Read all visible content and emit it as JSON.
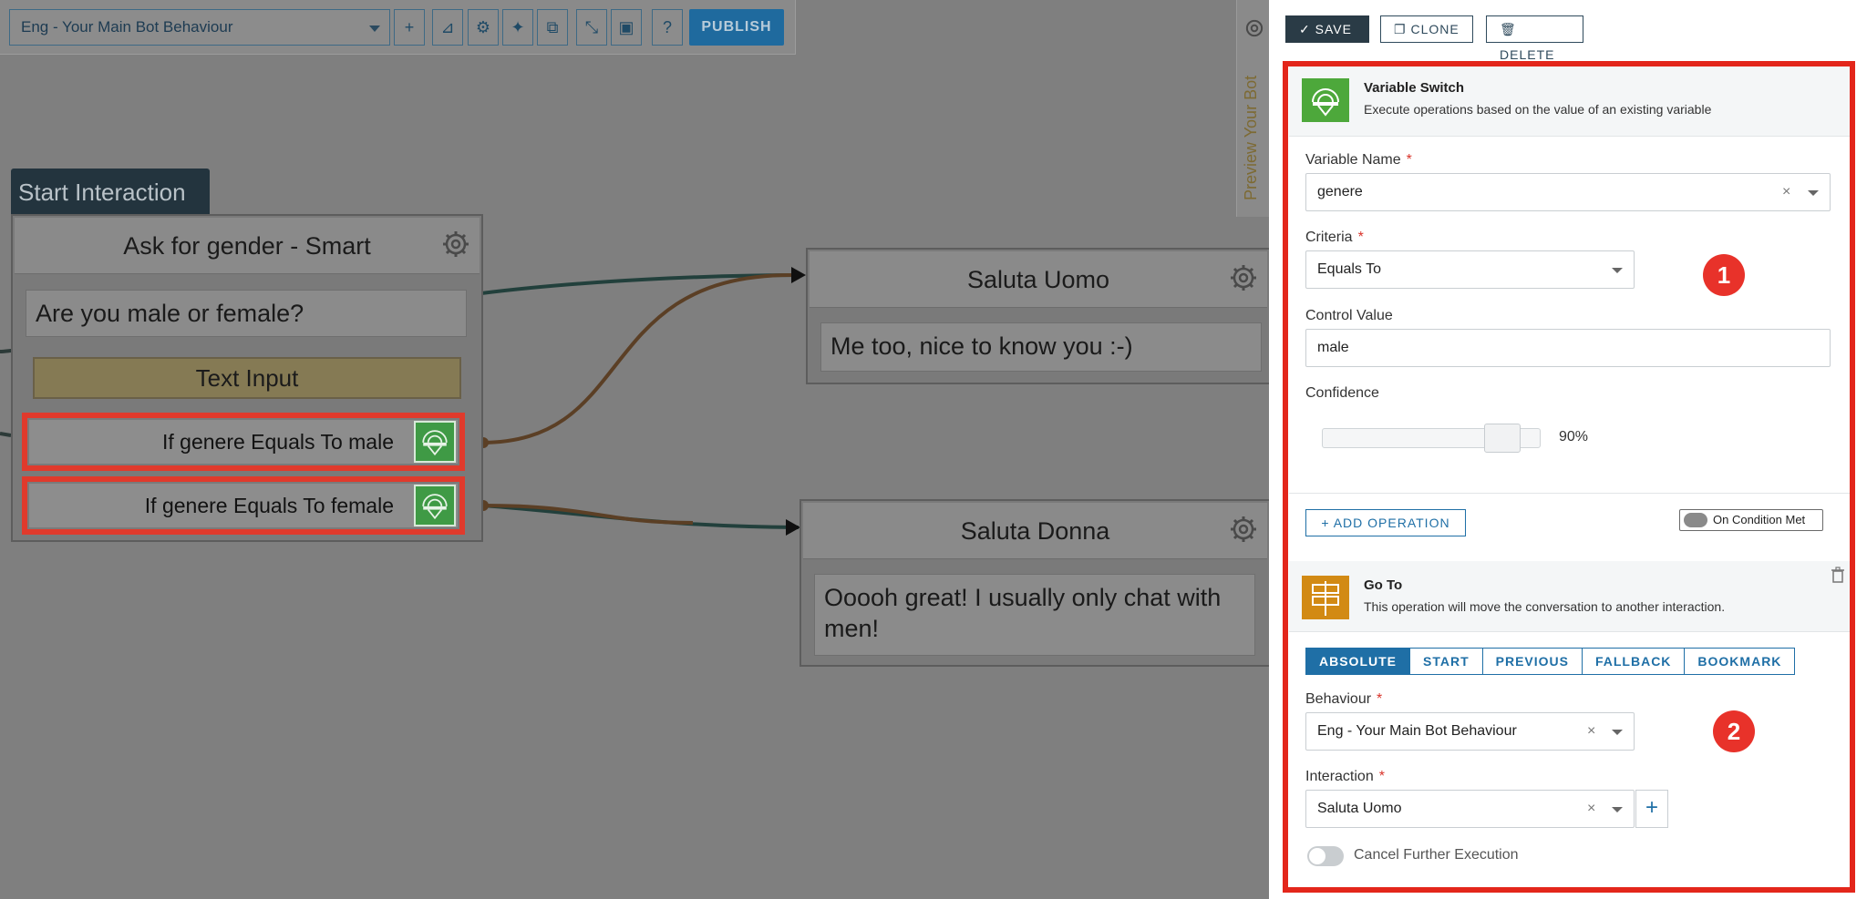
{
  "toolbar": {
    "behaviour_select": "Eng - Your Main Bot Behaviour",
    "publish_label": "PUBLISH"
  },
  "canvas": {
    "start_tag": "Start Interaction",
    "node_ask": {
      "title": "Ask for gender - Smart",
      "bubble": "Are you male or female?",
      "input_chip": "Text Input",
      "conditions": [
        "If genere Equals To male",
        "If genere Equals To female"
      ]
    },
    "node_uomo": {
      "title": "Saluta Uomo",
      "bubble": "Me too, nice to know you :-)"
    },
    "node_donna": {
      "title": "Saluta Donna",
      "bubble": "Ooooh great! I usually only chat with men!"
    },
    "preview_tab": "Preview Your Bot"
  },
  "panel": {
    "actions": {
      "save": "SAVE",
      "clone": "CLONE",
      "delete": "DELETE"
    },
    "variable_switch": {
      "title": "Variable Switch",
      "description": "Execute operations based on the value of an existing variable",
      "variable_name_label": "Variable Name",
      "variable_name_value": "genere",
      "criteria_label": "Criteria",
      "criteria_value": "Equals To",
      "control_value_label": "Control Value",
      "control_value": "male",
      "confidence_label": "Confidence",
      "confidence_value": "90%",
      "confidence_level": 0.9,
      "add_operation": "+ ADD OPERATION",
      "on_condition": "On Condition Met"
    },
    "goto": {
      "title": "Go To",
      "description": "This operation will move the conversation to another interaction.",
      "tabs": [
        "ABSOLUTE",
        "START",
        "PREVIOUS",
        "FALLBACK",
        "BOOKMARK"
      ],
      "active_tab": "ABSOLUTE",
      "behaviour_label": "Behaviour",
      "behaviour_value": "Eng - Your Main Bot Behaviour",
      "interaction_label": "Interaction",
      "interaction_value": "Saluta Uomo",
      "cancel_label": "Cancel Further Execution"
    },
    "badges": [
      "1",
      "2"
    ]
  },
  "colors": {
    "accent": "#1f6fa6",
    "highlight_red": "#e3261b",
    "switch_icon_green": "#4da83b",
    "goto_icon_orange": "#d28a14"
  }
}
